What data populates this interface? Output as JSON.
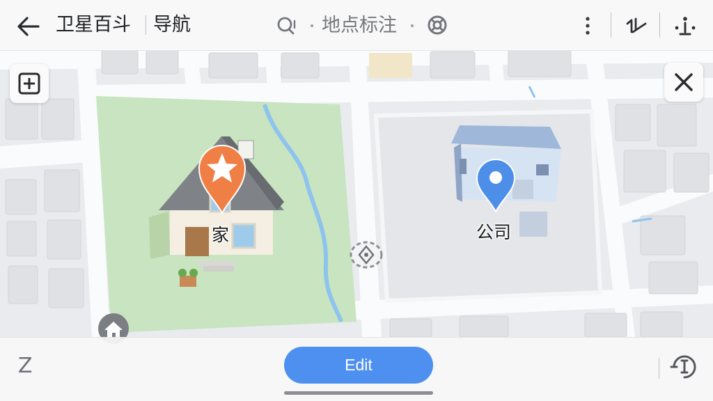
{
  "header": {
    "back_icon": "arrow-left-icon",
    "title": "卫星百斗",
    "subtitle": "导航",
    "search_icon": "search-chat-icon",
    "map_pin_label": "地点标注",
    "settings_icon": "lifebuoy-icon",
    "more_icon": "more-vertical-icon",
    "tool_icon_1": "route-measure-icon",
    "tool_icon_2": "location-info-icon"
  },
  "map_controls": {
    "add_icon": "plus-square-icon",
    "close_icon": "close-icon",
    "compass_icon": "compass-icon"
  },
  "markers": [
    {
      "label": "家",
      "type": "home",
      "pin_color": "#ef7f45",
      "icon": "star-icon"
    },
    {
      "label": "公司",
      "type": "work",
      "pin_color": "#4d8fe8",
      "icon": "location-pin-icon"
    }
  ],
  "poi": {
    "icon": "house-icon"
  },
  "bottom_bar": {
    "left_label": "Z",
    "edit_label": "Edit",
    "right_icon": "timer-info-icon"
  },
  "colors": {
    "accent": "#4d90ef",
    "park": "#c8e4c0",
    "water": "#8ec3ee"
  }
}
